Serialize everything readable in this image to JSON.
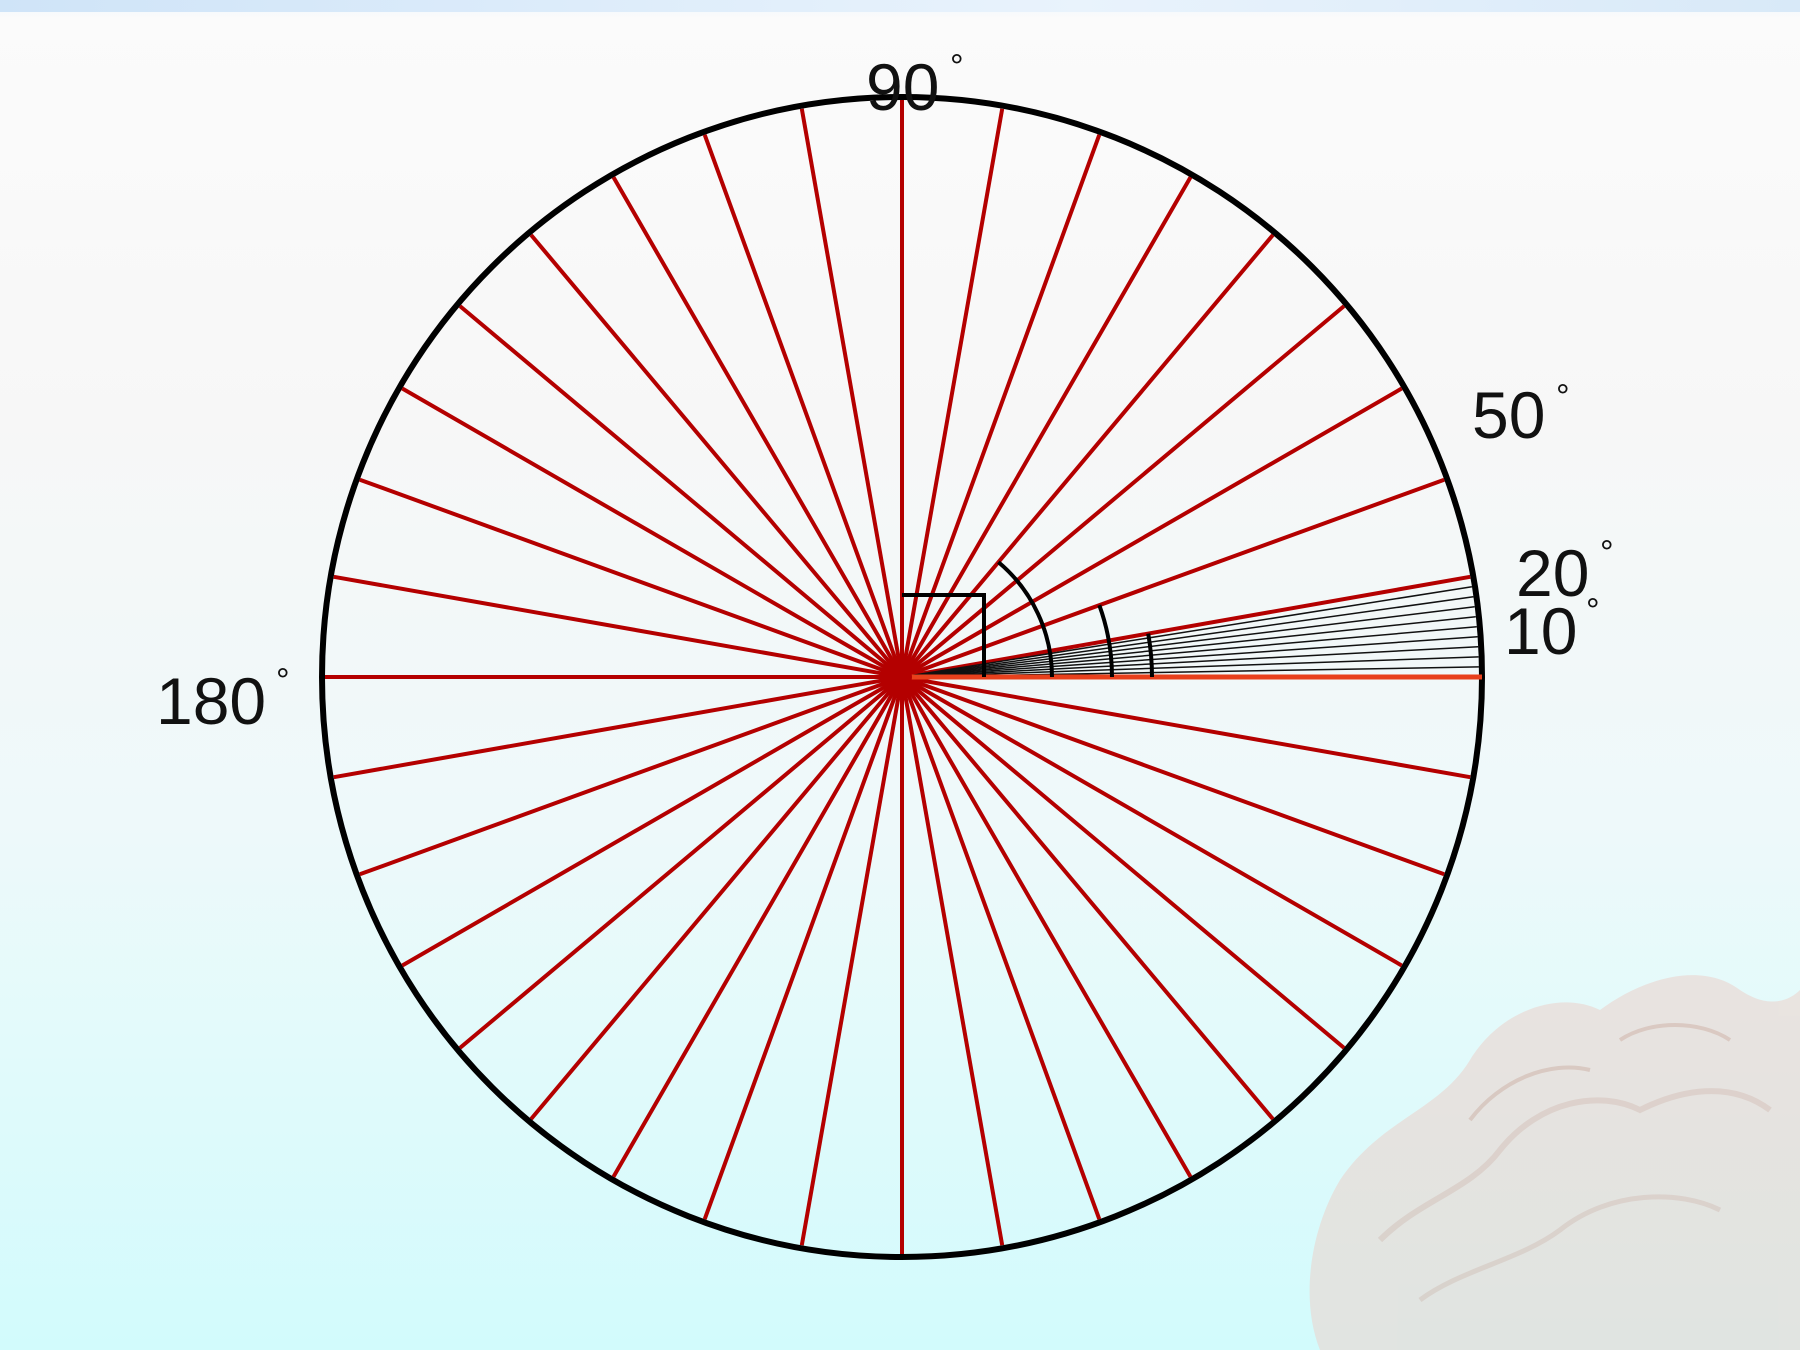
{
  "colors": {
    "spoke": "#b40000",
    "fine_ray": "#111111",
    "base_ray": "#e8401c",
    "circle": "#000000",
    "decor": "#e9c6be"
  },
  "diagram": {
    "spoke_step_degrees": 10,
    "fine_ray_step_degrees": 1,
    "fine_ray_max_degrees": 10,
    "angle_marks_degrees": [
      90,
      50,
      20,
      10
    ],
    "labels": [
      {
        "text": "90",
        "sign": "°"
      },
      {
        "text": "50",
        "sign": "°"
      },
      {
        "text": "20",
        "sign": "°"
      },
      {
        "text": "10",
        "sign": "°"
      },
      {
        "text": "180",
        "sign": "°"
      }
    ]
  }
}
